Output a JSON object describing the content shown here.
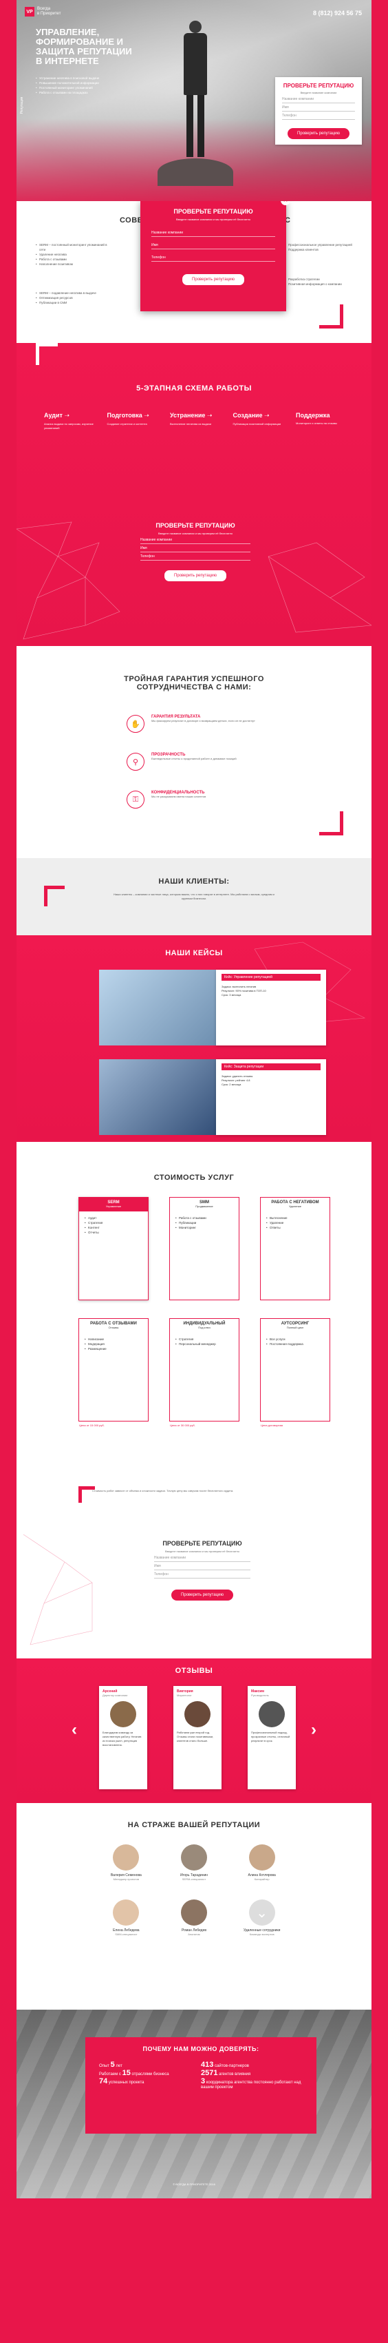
{
  "brand": {
    "name_line1": "Всегда",
    "name_line2": "в Приоритет",
    "phone": "8 (812) 924 56 75",
    "side_text": "Репутация"
  },
  "hero": {
    "title_l1": "УПРАВЛЕНИЕ,",
    "title_l2": "ФОРМИРОВАНИЕ И",
    "title_l3": "ЗАЩИТА РЕПУТАЦИИ",
    "title_l4": "В ИНТЕРНЕТЕ",
    "bullets": [
      "Устранение негатива в поисковой выдаче",
      "Повышение положительной информации",
      "Постоянный мониторинг упоминаний",
      "Работа с отзывами на площадках"
    ],
    "form": {
      "title": "ПРОВЕРЬТЕ РЕПУТАЦИЮ",
      "subtitle": "Введите название компании",
      "ph_company": "Название компании",
      "ph_name": "Имя",
      "ph_phone": "Телефон",
      "button": "Проверить репутацию"
    }
  },
  "modal": {
    "title": "ПРОВЕРЬТЕ РЕПУТАЦИЮ",
    "close": "×",
    "subtitle": "Введите название компании и мы проверим её бесплатно",
    "ph_company": "Название компании",
    "ph_name": "Имя",
    "ph_phone": "Телефон",
    "button": "Проверить репутацию"
  },
  "sovet": {
    "title": "СОВЕТ",
    "title_right": "С",
    "col1": [
      "SERM – постоянный мониторинг упоминаний в сети",
      "Удаление негатива",
      "Работа с отзывами",
      "Наполнение позитивом"
    ],
    "col2": [
      "SERM – подавление негатива в выдаче",
      "Оптимизация ресурсов",
      "Публикации в СМИ"
    ],
    "col3": [
      "Профессиональное управление репутацией",
      "Поддержка клиентов"
    ],
    "col4": [
      "Разработка стратегии",
      "Позитивная информация о компании"
    ]
  },
  "scheme": {
    "title": "5-ЭТАПНАЯ СХЕМА РАБОТЫ",
    "steps": [
      {
        "name": "Аудит",
        "text": "Анализ выдачи по запросам, изучение упоминаний"
      },
      {
        "name": "Подготовка",
        "text": "Создание стратегии и контента"
      },
      {
        "name": "Устранение",
        "text": "Вытеснение негатива из выдачи"
      },
      {
        "name": "Создание",
        "text": "Публикация позитивной информации"
      },
      {
        "name": "Поддержка",
        "text": "Мониторинг и ответы на отзывы"
      }
    ]
  },
  "form2": {
    "title": "ПРОВЕРЬТЕ РЕПУТАЦИЮ",
    "subtitle": "Введите название компании и мы проверим её бесплатно",
    "ph_company": "Название компании",
    "ph_name": "Имя",
    "ph_phone": "Телефон",
    "button": "Проверить репутацию"
  },
  "guarantee": {
    "title_l1": "ТРОЙНАЯ ГАРАНТИЯ УСПЕШНОГО",
    "title_l2": "СОТРУДНИЧЕСТВА С НАМИ:",
    "items": [
      {
        "head": "ГАРАНТИЯ РЕЗУЛЬТАТА",
        "text": "Мы фиксируем результат в договоре и возвращаем деньги, если он не достигнут"
      },
      {
        "head": "ПРОЗРАЧНОСТЬ",
        "text": "Еженедельные отчеты о проделанной работе и динамике позиций"
      },
      {
        "head": "КОНФИДЕНЦИАЛЬНОСТЬ",
        "text": "Мы не раскрываем имена наших клиентов"
      }
    ]
  },
  "clients": {
    "title": "НАШИ КЛИЕНТЫ:",
    "text": "Наши клиенты – компании и частные лица, которым важно, что о них говорят в интернете. Мы работаем с малым, средним и крупным бизнесом."
  },
  "cases": {
    "title": "НАШИ КЕЙСЫ",
    "items": [
      {
        "head": "Кейс: Управление репутацией",
        "lines": [
          "Задача: вытеснить негатив",
          "Результат: 90% позитива в ТОП-10",
          "Срок: 3 месяца"
        ]
      },
      {
        "head": "Кейс: Защита репутации",
        "lines": [
          "Задача: удалить отзывы",
          "Результат: рейтинг 4.8",
          "Срок: 2 месяца"
        ]
      }
    ]
  },
  "pricing": {
    "title": "СТОИМОСТЬ УСЛУГ",
    "plans": [
      {
        "name": "SERM",
        "sub": "Управление",
        "items": [
          "Аудит",
          "Стратегия",
          "Контент",
          "Отчеты"
        ],
        "price": ""
      },
      {
        "name": "SMM",
        "sub": "Продвижение",
        "items": [
          "Работа с отзывами",
          "Публикации",
          "Мониторинг"
        ],
        "price": ""
      },
      {
        "name": "РАБОТА С НЕГАТИВОМ",
        "sub": "Удаление",
        "items": [
          "Вытеснение",
          "Удаление",
          "Ответы"
        ],
        "price": ""
      },
      {
        "name": "РАБОТА С ОТЗЫВАМИ",
        "sub": "Отзывы",
        "items": [
          "Написание",
          "Модерация",
          "Размещение"
        ],
        "price": "Цена от 15 000 руб."
      },
      {
        "name": "ИНДИВИДУАЛЬНЫЙ",
        "sub": "Под ключ",
        "items": [
          "Стратегия",
          "Персональный менеджер"
        ],
        "price": "Цена от 30 000 руб."
      },
      {
        "name": "АУТСОРСИНГ",
        "sub": "Полный цикл",
        "items": [
          "Все услуги",
          "Постоянная поддержка"
        ],
        "price": "Цена договорная"
      }
    ],
    "note": "Стоимость работ зависит от объема и сложности задачи. Точную цену мы озвучим после бесплатного аудита."
  },
  "form3": {
    "title": "ПРОВЕРЬТЕ РЕПУТАЦИЮ",
    "subtitle": "Введите название компании и мы проверим её бесплатно",
    "ph_company": "Название компании",
    "ph_name": "Имя",
    "ph_phone": "Телефон",
    "button": "Проверить репутацию"
  },
  "reviews": {
    "title": "ОТЗЫВЫ",
    "prev": "‹",
    "next": "›",
    "items": [
      {
        "name": "Арсений",
        "role": "Директор компании",
        "text": "Благодарим команду за качественную работу. Негатив из поиска ушел, репутация восстановлена."
      },
      {
        "name": "Виктория",
        "role": "Маркетолог",
        "text": "Работаем уже второй год. Отзывы стали позитивными, клиентов стало больше."
      },
      {
        "name": "Максим",
        "role": "Руководитель",
        "text": "Профессиональный подход, прозрачные отчеты, отличный результат в срок."
      }
    ]
  },
  "team": {
    "title": "НА СТРАЖЕ ВАШЕЙ РЕПУТАЦИИ",
    "members": [
      {
        "name": "Валерия Семенова",
        "role": "Менеджер проектов"
      },
      {
        "name": "Игорь Тарадинин",
        "role": "SERM-специалист"
      },
      {
        "name": "Алина Котлярова",
        "role": "Копирайтер"
      },
      {
        "name": "Елена Лебедева",
        "role": "SMM-специалист"
      },
      {
        "name": "Роман Лебедев",
        "role": "Аналитик"
      },
      {
        "name": "Удаленные сотрудники",
        "role": "Команда экспертов"
      }
    ]
  },
  "why": {
    "title": "ПОЧЕМУ НАМ МОЖНО ДОВЕРЯТЬ:",
    "left": [
      {
        "num": "5",
        "pre": "Опыт",
        "text": "лет"
      },
      {
        "num": "15",
        "pre": "Работаем с",
        "text": "отраслями бизнеса"
      },
      {
        "num": "74",
        "pre": "",
        "text": "успешных проекта"
      }
    ],
    "right": [
      {
        "num": "413",
        "text": "сайтов-партнеров"
      },
      {
        "num": "2571",
        "text": "агентов влияния"
      },
      {
        "num": "3",
        "text": "координатора агентства постоянно работают над вашим проектом"
      }
    ]
  },
  "footer": {
    "text": "© ВСЕГДА В ПРИОРИТЕТЕ 2016"
  }
}
